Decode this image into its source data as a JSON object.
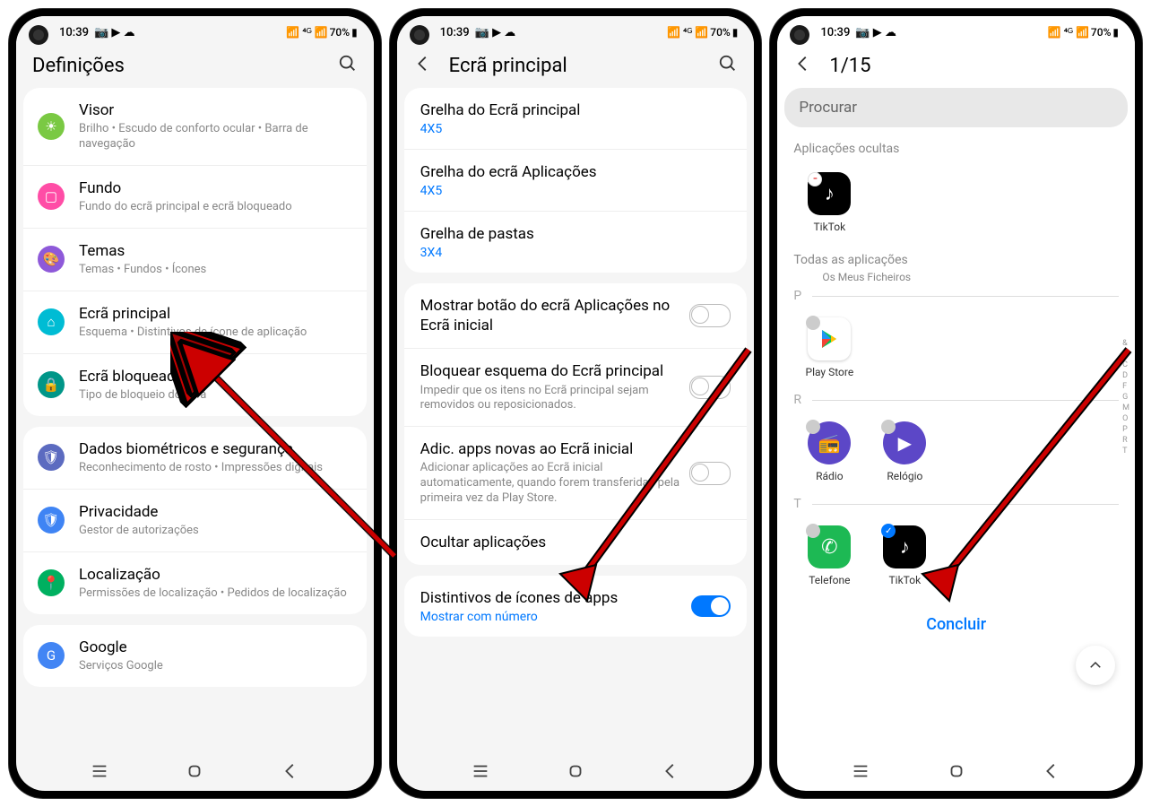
{
  "status": {
    "time": "10:39",
    "battery": "70%"
  },
  "screen1": {
    "title": "Definições",
    "items": [
      {
        "title": "Visor",
        "sub": "Brilho  •  Escudo de conforto ocular  •  Barra de navegação",
        "color": "#7ac943"
      },
      {
        "title": "Fundo",
        "sub": "Fundo do ecrã principal e ecrã bloqueado",
        "color": "#ff4da6"
      },
      {
        "title": "Temas",
        "sub": "Temas  •  Fundos  •  Ícones",
        "color": "#8e59d9"
      },
      {
        "title": "Ecrã principal",
        "sub": "Esquema  •  Distintivos de ícone de aplicação",
        "color": "#00bcd4"
      },
      {
        "title": "Ecrã bloqueado",
        "sub": "Tipo de bloqueio do ecrã",
        "color": "#009688"
      },
      {
        "title": "Dados biométricos e segurança",
        "sub": "Reconhecimento de rosto  •  Impressões digitais",
        "color": "#5c6bc0"
      },
      {
        "title": "Privacidade",
        "sub": "Gestor de autorizações",
        "color": "#3f84f4"
      },
      {
        "title": "Localização",
        "sub": "Permissões de localização  •  Pedidos de localização",
        "color": "#00b060"
      },
      {
        "title": "Google",
        "sub": "Serviços Google",
        "color": "#4285f4"
      }
    ]
  },
  "screen2": {
    "title": "Ecrã principal",
    "grid": [
      {
        "title": "Grelha do Ecrã principal",
        "value": "4X5"
      },
      {
        "title": "Grelha do ecrã Aplicações",
        "value": "4X5"
      },
      {
        "title": "Grelha de pastas",
        "value": "3X4"
      }
    ],
    "toggles": [
      {
        "title": "Mostrar botão do ecrã Aplicações no Ecrã inicial",
        "sub": "",
        "on": false
      },
      {
        "title": "Bloquear esquema do Ecrã principal",
        "sub": "Impedir que os itens no Ecrã principal sejam removidos ou reposicionados.",
        "on": false
      },
      {
        "title": "Adic. apps novas ao Ecrã inicial",
        "sub": "Adicionar aplicações ao Ecrã inicial automaticamente, quando forem transferidas pela primeira vez da Play Store.",
        "on": false
      }
    ],
    "hide": "Ocultar aplicações",
    "badges": {
      "title": "Distintivos de ícones de apps",
      "value": "Mostrar com número",
      "on": true
    }
  },
  "screen3": {
    "counter": "1/15",
    "search": "Procurar",
    "hidden_label": "Aplicações ocultas",
    "hidden_app": "TikTok",
    "all_label": "Todas as aplicações",
    "partial": "Os Meus Ficheiros",
    "sections": {
      "P": [
        {
          "name": "Play Store"
        }
      ],
      "R": [
        {
          "name": "Rádio"
        },
        {
          "name": "Relógio"
        }
      ],
      "T": [
        {
          "name": "Telefone"
        },
        {
          "name": "TikTok",
          "checked": true
        }
      ]
    },
    "index": [
      "&",
      "A",
      "C",
      "D",
      "F",
      "G",
      "M",
      "O",
      "P",
      "R",
      "T"
    ],
    "done": "Concluir"
  }
}
